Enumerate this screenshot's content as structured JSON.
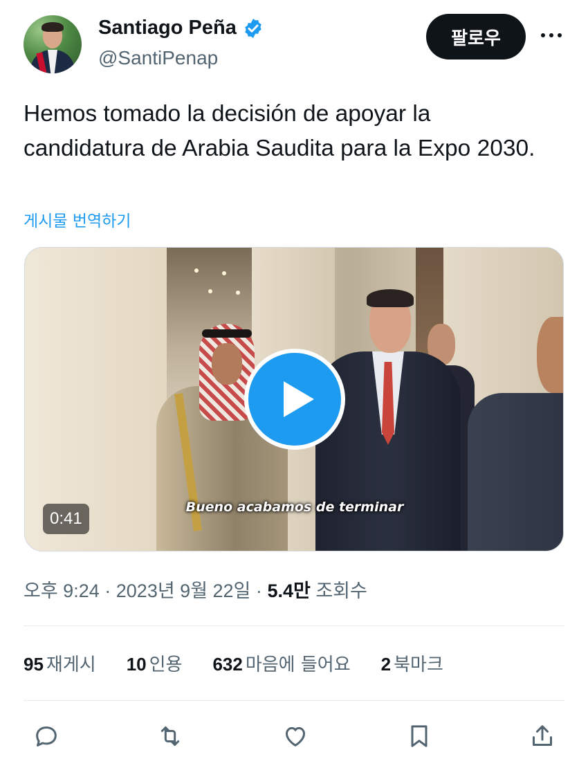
{
  "author": {
    "name": "Santiago Peña",
    "handle": "@SantiPenap",
    "verified": true
  },
  "header": {
    "follow_label": "팔로우",
    "more_icon": "more-horizontal-icon"
  },
  "tweet": {
    "text": "Hemos tomado la decisión de apoyar la candidatura de Arabia Saudita para la Expo 2030.",
    "translate_label": "게시물 번역하기"
  },
  "media": {
    "type": "video",
    "duration": "0:41",
    "caption": "Bueno acabamos de terminar",
    "play_icon": "play-icon"
  },
  "meta": {
    "time": "오후 9:24",
    "separator": "·",
    "date": "2023년 9월 22일",
    "views_count": "5.4만",
    "views_label": "조회수"
  },
  "stats": [
    {
      "count": "95",
      "label": "재게시"
    },
    {
      "count": "10",
      "label": "인용"
    },
    {
      "count": "632",
      "label": "마음에 들어요"
    },
    {
      "count": "2",
      "label": "북마크"
    }
  ],
  "actions": [
    "reply-icon",
    "repost-icon",
    "like-icon",
    "bookmark-icon",
    "share-icon"
  ],
  "colors": {
    "accent": "#1d9bf0",
    "text_primary": "#0f1419",
    "text_secondary": "#536471",
    "follow_button": "#0f1419"
  }
}
